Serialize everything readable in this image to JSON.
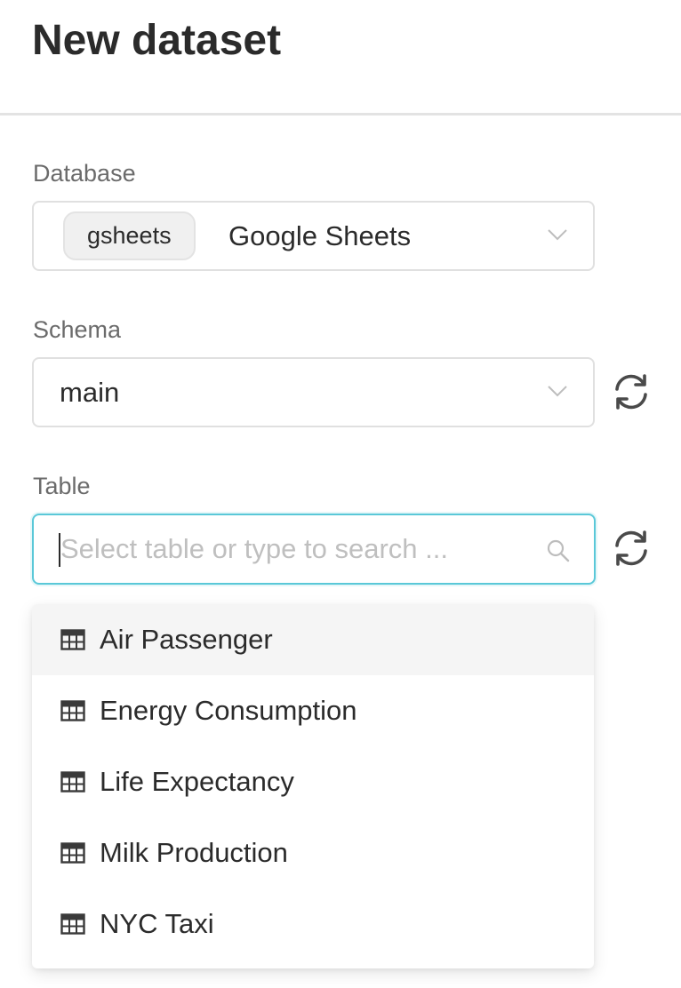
{
  "header": {
    "title": "New dataset"
  },
  "database": {
    "label": "Database",
    "tag": "gsheets",
    "value": "Google Sheets"
  },
  "schema": {
    "label": "Schema",
    "value": "main"
  },
  "table": {
    "label": "Table",
    "value": "",
    "placeholder": "Select table or type to search ..."
  },
  "dropdown": {
    "options": [
      {
        "label": "Air Passenger"
      },
      {
        "label": "Energy Consumption"
      },
      {
        "label": "Life Expectancy"
      },
      {
        "label": "Milk Production"
      },
      {
        "label": "NYC Taxi"
      }
    ]
  },
  "colors": {
    "focus_border": "#5ac8d8",
    "text": "#2b2b2b",
    "label": "#6b6b6b",
    "placeholder": "#bfbfbf",
    "hover_row": "#f5f5f5"
  },
  "icons": {
    "chevron": "chevron-down-icon",
    "refresh": "refresh-icon",
    "search": "search-icon",
    "table": "table-icon"
  }
}
